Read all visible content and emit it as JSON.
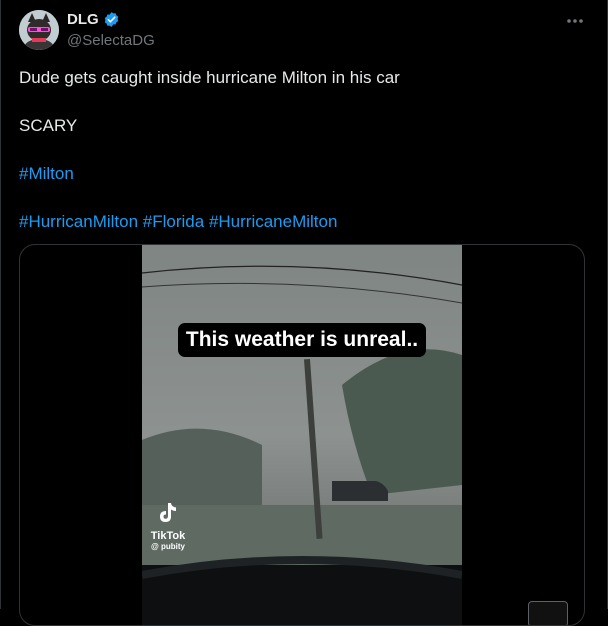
{
  "author": {
    "display_name": "DLG",
    "handle": "@SelectaDG",
    "verified": true
  },
  "tweet": {
    "line1": "Dude gets caught inside hurricane Milton in his car",
    "line2": "SCARY",
    "hashtag_milton": "#Milton",
    "hashtags_row": [
      "#HurricanMilton",
      "#Florida",
      "#HurricaneMilton"
    ]
  },
  "video": {
    "caption": "This weather is unreal..",
    "watermark_name": "TikTok",
    "watermark_user": "@ pubity"
  },
  "icons": {
    "verified": "verified-badge-icon",
    "more": "more-options-icon",
    "tiktok": "tiktok-logo-icon"
  },
  "colors": {
    "background": "#000000",
    "text": "#e7e9ea",
    "secondary": "#71767b",
    "link": "#1d9bf0",
    "verified": "#1d9bf0",
    "border": "#2f3336"
  }
}
